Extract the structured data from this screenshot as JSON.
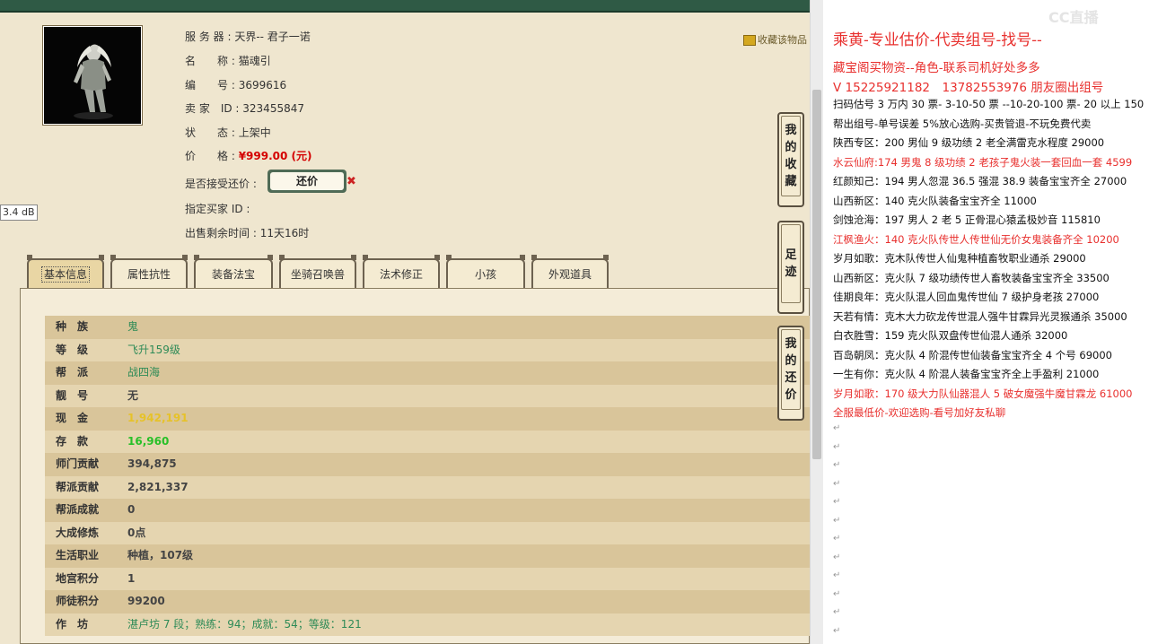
{
  "favorite_link": "收藏该物品",
  "character": {
    "server_label": "服 务 器 :",
    "server": "天界-- 君子一诺",
    "name_label": "名　　称 :",
    "name": "猫魂引",
    "id_label": "编　　号 :",
    "id": "3699616",
    "seller_label": "卖 家　ID :",
    "seller_id": "323455847",
    "status_label": "状　　态 :",
    "status": "上架中",
    "price_label": "价　　格 :",
    "price": "¥999.00 (元)",
    "counter_label": "是否接受还价 :",
    "counter_button": "还价",
    "counter_x": "✖",
    "buyer_label": "指定买家 ID :",
    "buyer_id": "",
    "remaining_label": "出售剩余时间 :",
    "remaining": "11天16时"
  },
  "db_tag": "3.4 dB",
  "tabs": [
    "基本信息",
    "属性抗性",
    "装备法宝",
    "坐骑召唤兽",
    "法术修正",
    "小孩",
    "外观道具"
  ],
  "attributes": [
    {
      "k": "种　族",
      "v": "鬼",
      "color": "#2e8b57"
    },
    {
      "k": "等　级",
      "v": "飞升159级",
      "color": "#2e8b57"
    },
    {
      "k": "帮　派",
      "v": "战四海",
      "color": "#2e8b57"
    },
    {
      "k": "靓　号",
      "v": "无",
      "color": "#444444"
    },
    {
      "k": "现　金",
      "v": "1,942,191",
      "color": "#e6c229"
    },
    {
      "k": "存　款",
      "v": "16,960",
      "color": "#28c028"
    },
    {
      "k": "师门贡献",
      "v": "394,875",
      "color": "#444444"
    },
    {
      "k": "帮派贡献",
      "v": "2,821,337",
      "color": "#444444"
    },
    {
      "k": "帮派成就",
      "v": "0",
      "color": "#444444"
    },
    {
      "k": "大成修炼",
      "v": "0点",
      "color": "#444444"
    },
    {
      "k": "生活职业",
      "v": "种植，107级",
      "color": "#444444"
    },
    {
      "k": "地宫积分",
      "v": "1",
      "color": "#444444"
    },
    {
      "k": "师徒积分",
      "v": "99200",
      "color": "#444444"
    },
    {
      "k": "作　坊",
      "v": "湛卢坊 7 段；熟练：94；成就：54；等级：121",
      "color": "#2e8b57"
    }
  ],
  "side_buttons": [
    "我的收藏",
    "足迹",
    "我的还价"
  ],
  "watermark": "CC直播",
  "notes": {
    "title": "乘黄-专业估价-代卖组号-找号--",
    "lines": [
      {
        "t": "藏宝阁买物资--角色-联系司机好处多多",
        "red": true
      },
      {
        "t": "V 15225921182　13782553976 朋友圈出组号",
        "red": true
      },
      {
        "t": "扫码估号 3 万内 30 票- 3-10-50 票 --10-20-100 票- 20 以上 150",
        "red": false
      },
      {
        "t": "帮出组号-单号误差 5%放心选购-买贵管退-不玩免费代卖",
        "red": false
      },
      {
        "t": "陕西专区：200 男仙 9 级功绩 2 老全满雷克水程度 29000",
        "red": false
      },
      {
        "t": "水云仙府:174 男鬼 8 级功绩 2 老孩子鬼火装一套回血一套 4599",
        "red": true
      },
      {
        "t": "红颜知己：194 男人忽混 36.5 强混 38.9 装备宝宝齐全 27000",
        "red": false
      },
      {
        "t": "山西新区：140 克火队装备宝宝齐全 11000",
        "red": false
      },
      {
        "t": "剑蚀沧海：197 男人 2 老 5 正骨混心猿孟极妙音 115810",
        "red": false
      },
      {
        "t": "江枫渔火：140 克火队传世人传世仙无价女鬼装备齐全 10200",
        "red": true
      },
      {
        "t": "岁月如歌：克木队传世人仙鬼种植畜牧职业通杀 29000",
        "red": false
      },
      {
        "t": "山西新区：克火队 7 级功绩传世人畜牧装备宝宝齐全 33500",
        "red": false
      },
      {
        "t": "佳期良年：克火队混人回血鬼传世仙 7 级护身老孩 27000",
        "red": false
      },
      {
        "t": "天若有情：克木大力砍龙传世混人强牛甘霖异光灵猴通杀 35000",
        "red": false
      },
      {
        "t": "白衣胜雪：159 克火队双盘传世仙混人通杀 32000",
        "red": false
      },
      {
        "t": "百岛朝凤：克火队 4 阶混传世仙装备宝宝齐全 4 个号 69000",
        "red": false
      },
      {
        "t": "一生有你：克火队 4 阶混人装备宝宝齐全上手盈利 21000",
        "red": false
      },
      {
        "t": "岁月如歌：170 级大力队仙器混人 5 破女魔强牛魔甘霖龙 61000",
        "red": true
      },
      {
        "t": "全服最低价-欢迎选购-看号加好友私聊",
        "red": true
      }
    ]
  }
}
